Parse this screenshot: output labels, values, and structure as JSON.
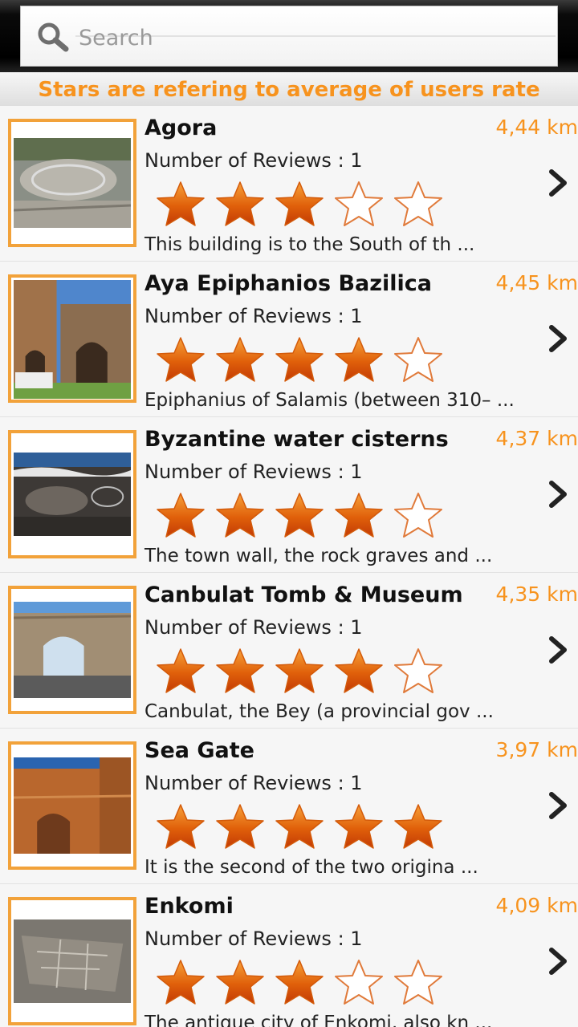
{
  "search": {
    "placeholder": "Search",
    "value": ""
  },
  "banner": "Stars are refering to average of users rate",
  "colors": {
    "accent": "#f7931e",
    "frame": "#f2a23a",
    "star_fill": "#e2640b"
  },
  "items": [
    {
      "title": "Agora",
      "distance": "4,44 km",
      "reviews": "Number of Reviews : 1",
      "rating": 3,
      "desc": "This building is to the South of th ..."
    },
    {
      "title": "Aya Epiphanios Bazilica",
      "distance": "4,45 km",
      "reviews": "Number of Reviews : 1",
      "rating": 4,
      "desc": "Epiphanius of Salamis (between 310– ..."
    },
    {
      "title": "Byzantine water cisterns",
      "distance": "4,37 km",
      "reviews": "Number of Reviews : 1",
      "rating": 4,
      "desc": "The town wall, the rock graves and ..."
    },
    {
      "title": "Canbulat Tomb & Museum",
      "distance": "4,35 km",
      "reviews": "Number of Reviews : 1",
      "rating": 4,
      "desc": "Canbulat, the Bey (a provincial gov ..."
    },
    {
      "title": "Sea Gate",
      "distance": "3,97 km",
      "reviews": "Number of Reviews : 1",
      "rating": 5,
      "desc": "It is the second of the two origina ..."
    },
    {
      "title": "Enkomi",
      "distance": "4,09 km",
      "reviews": "Number of Reviews : 1",
      "rating": 3,
      "desc": "The antique city of Enkomi, also kn ..."
    }
  ],
  "icons": {
    "search": "search-icon",
    "chevron": "chevron-right-icon",
    "star_filled": "star-filled-icon",
    "star_empty": "star-empty-icon"
  }
}
